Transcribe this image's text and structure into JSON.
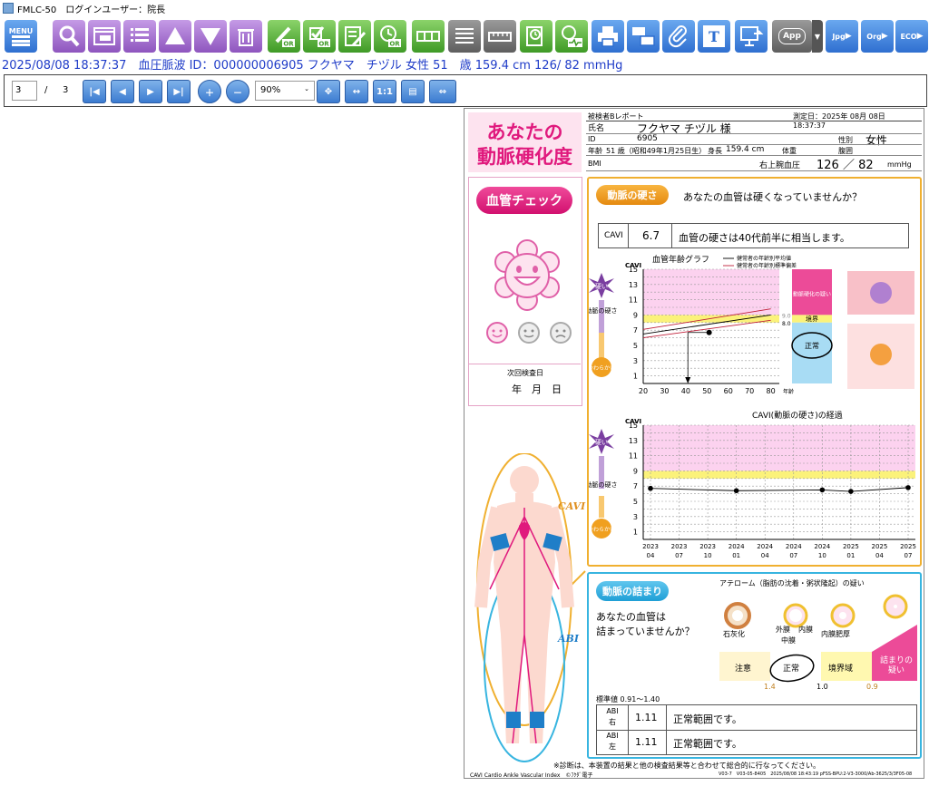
{
  "window": {
    "title": "FMLC-50　ログインユーザー：院長"
  },
  "toolbar": {
    "menu_label": "MENU",
    "app_label": "App",
    "jpg_label": "Jpg",
    "org_label": "Org",
    "eco_label": "ECO",
    "text_label": "T"
  },
  "patient_line": "2025/08/08 18:37:37　血圧脈波 ID：000000006905 フクヤマ　チヅル 女性 51　歳 159.4 cm 126/ 82 mmHg",
  "nav": {
    "page_current": "3",
    "page_sep": "/",
    "page_total": "3",
    "zoom": "90%",
    "fit_label": "1:1"
  },
  "report": {
    "header_title_1": "あなたの",
    "header_title_2": "動脈硬化度",
    "report_type": "被検者Bレポート",
    "measure_date": "測定日：2025年 08月 08日　18:37:37",
    "name_label": "氏名",
    "name_value": "フクヤマ チヅル 様",
    "id_label": "ID",
    "id_value": "6905",
    "sex_label": "性別",
    "sex_value": "女性",
    "age_label": "年齢",
    "age_value": "51 歳（昭和49年1月25日生）",
    "height_label": "身長",
    "height_value": "159.4 cm",
    "weight_label": "体重",
    "waist_label": "腹囲",
    "bmi_label": "BMI",
    "bp_label": "右上腕血圧",
    "bp_value": "126 ／ 82",
    "bp_unit": "mmHg",
    "vessel_check": "血管チェック",
    "next_exam_label": "次回検査日",
    "next_exam_value": "年　月　日",
    "cavi_side_label": "CAVI",
    "abi_side_label": "ABI",
    "hardness_badge": "動脈の硬さ",
    "hardness_question": "あなたの血管は硬くなっていませんか？",
    "cavi_label": "CAVI",
    "cavi_value": "6.7",
    "cavi_comment": "血管の硬さは40代前半に相当します。",
    "age_graph_title": "血管年齢グラフ",
    "legend_mean": "健常者の年齢別平均値",
    "legend_sd": "健常者の年齢別標準偏差",
    "y_title": "CAVI",
    "hard_label": "硬い",
    "soft_label": "やわらかい",
    "stiffness_label": "動脈の硬さ",
    "age_axis_unit": "年齢",
    "zone_suspect": "動脈硬化の疑い",
    "zone_border": "境界",
    "zone_normal": "正常",
    "ref_9": "9.0",
    "ref_8": "8.0",
    "trend_title": "CAVI(動脈の硬さ)の経過",
    "occlusion_badge": "動脈の詰まり",
    "occlusion_q1": "あなたの血管は",
    "occlusion_q2": "詰まっていませんか？",
    "atheroma_text": "アテローム（脂肪の沈着・粥状隆起）の疑い",
    "calcify_label": "石灰化",
    "outer_label": "外膜",
    "middle_label": "中膜",
    "inner_label": "内膜",
    "thick_label": "内膜肥厚",
    "abi_caution": "注意",
    "abi_normal": "正常",
    "abi_border": "境界域",
    "abi_suspect": "詰まりの疑い",
    "abi_t1": "1.4",
    "abi_t2": "1.0",
    "abi_t3": "0.9",
    "standard_value": "標準値 0.91〜1.40",
    "abi_r_label1": "ABI",
    "abi_r_label2": "右",
    "abi_r_value": "1.11",
    "abi_r_comment": "正常範囲です。",
    "abi_l_label1": "ABI",
    "abi_l_label2": "左",
    "abi_l_value": "1.11",
    "abi_l_comment": "正常範囲です。",
    "footer_note": "※診断は、本装置の結果と他の検査結果等と合わせて総合的に行なってください。",
    "footer_brand": "CAVI Cardio Ankle Vascular Index　©ﾌｸﾀﾞ電子",
    "footer_version": "V03-7　V03-05-8405　2025/08/08 18:43:19 pFSS-BPU:2-V3-3000/Ab-3625/3/3F05-08"
  },
  "chart_data": [
    {
      "type": "line",
      "title": "血管年齢グラフ",
      "xlabel": "年齢",
      "ylabel": "CAVI",
      "x_ticks": [
        20,
        30,
        40,
        50,
        60,
        70,
        80
      ],
      "y_ticks": [
        1,
        3,
        5,
        7,
        9,
        11,
        13,
        15
      ],
      "xlim": [
        20,
        84
      ],
      "ylim": [
        0,
        15
      ],
      "series": [
        {
          "name": "健常者の年齢別平均値",
          "x": [
            20,
            80
          ],
          "y": [
            6.5,
            9.0
          ]
        },
        {
          "name": "健常者の年齢別標準偏差",
          "x": [
            20,
            80
          ],
          "y": [
            7.1,
            9.8
          ]
        },
        {
          "name": "健常者の年齢別標準偏差",
          "x": [
            20,
            80
          ],
          "y": [
            6.0,
            8.3
          ]
        }
      ],
      "point": {
        "x": 51,
        "y": 6.7
      },
      "marker_age": 41
    },
    {
      "type": "line",
      "title": "CAVI(動脈の硬さ)の経過",
      "ylabel": "CAVI",
      "categories": [
        "2023 04",
        "2023 07",
        "2023 10",
        "2024 01",
        "2024 04",
        "2024 07",
        "2024 10",
        "2025 01",
        "2025 04",
        "2025 07"
      ],
      "x_top": [
        "2023",
        "2023",
        "2023",
        "2024",
        "2024",
        "2024",
        "2024",
        "2025",
        "2025",
        "2025"
      ],
      "x_bottom": [
        "04",
        "07",
        "10",
        "01",
        "04",
        "07",
        "10",
        "01",
        "04",
        "07"
      ],
      "y_ticks": [
        1,
        3,
        5,
        7,
        9,
        11,
        13,
        15
      ],
      "ylim": [
        0,
        15
      ],
      "points": [
        {
          "i": 0.0,
          "y": 6.7
        },
        {
          "i": 3.0,
          "y": 6.4
        },
        {
          "i": 6.0,
          "y": 6.5
        },
        {
          "i": 7.0,
          "y": 6.3
        },
        {
          "i": 9.0,
          "y": 6.8
        }
      ]
    }
  ],
  "colors": {
    "accent_pink": "#e0197d",
    "orange": "#f0a020",
    "blue_frame": "#38b5e0",
    "toolbar_purple": "#a070c8",
    "toolbar_green": "#5db83a",
    "toolbar_blue": "#3f8de0"
  }
}
